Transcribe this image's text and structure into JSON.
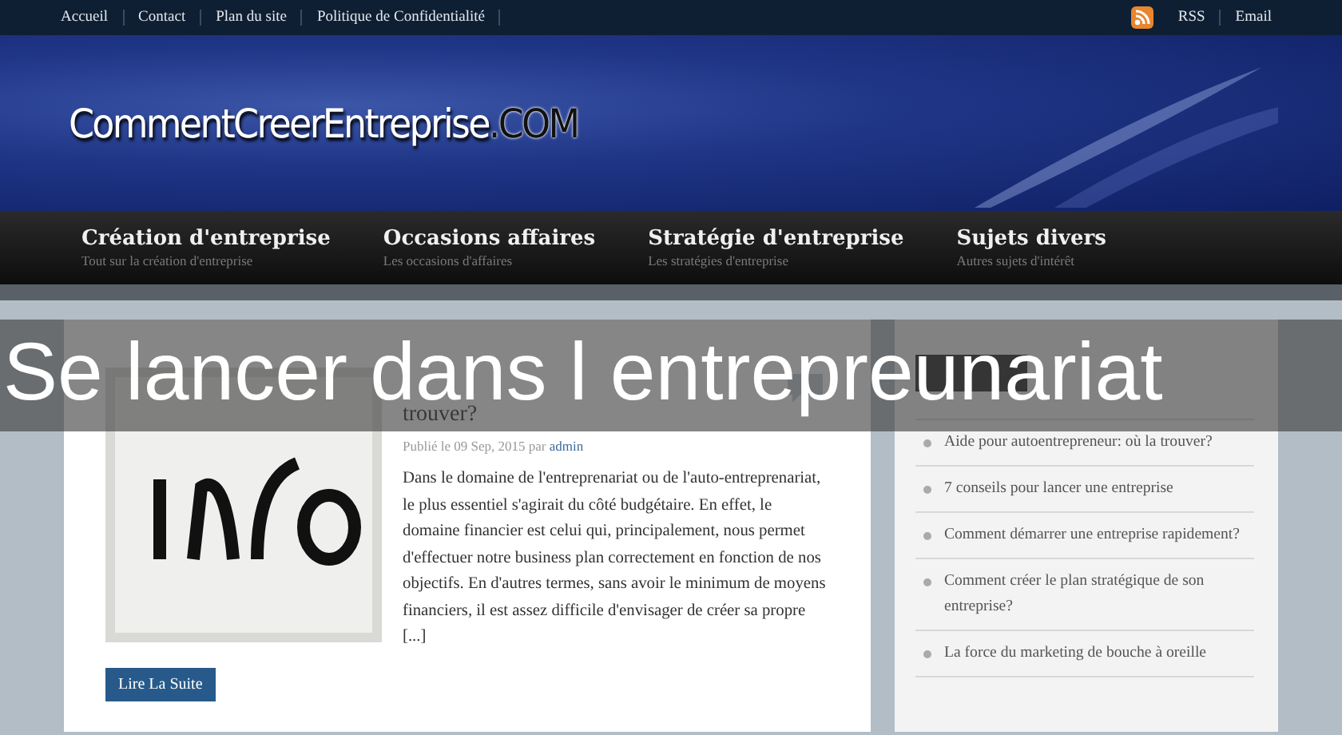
{
  "top_bar": {
    "links": [
      "Accueil",
      "Contact",
      "Plan du site",
      "Politique de Confidentialité"
    ],
    "right_links": [
      "RSS",
      "Email"
    ]
  },
  "logo": {
    "name": "CommentCreerEntreprise",
    "suffix": ".COM"
  },
  "nav": [
    {
      "label": "Création d'entreprise",
      "subtitle": "Tout sur la création d'entreprise"
    },
    {
      "label": "Occasions affaires",
      "subtitle": "Les occasions d'affaires"
    },
    {
      "label": "Stratégie d'entreprise",
      "subtitle": "Les stratégies d'entreprise"
    },
    {
      "label": "Sujets divers",
      "subtitle": "Autres sujets d'intérêt"
    }
  ],
  "post": {
    "title": "trouver?",
    "meta": "Publié le 09 Sep, 2015 par",
    "author": "admin",
    "excerpt": "Dans le domaine de l'entreprenariat ou de l'auto-entreprenariat, le plus essentiel s'agirait du côté budgétaire. En effet, le domaine financier est celui qui, principalement, nous permet d'effectuer notre business plan correctement en fonction de nos objectifs. En d'autres termes, sans avoir le minimum de moyens financiers, il est assez difficile d'envisager de créer sa propre [...]",
    "button": "Lire La Suite"
  },
  "sidebar": {
    "items": [
      "Aide pour autoentrepreneur: où la trouver?",
      "7 conseils pour lancer une entreprise",
      "Comment démarrer une entreprise rapidement?",
      "Comment créer le plan stratégique de son entreprise?",
      "La force du marketing de bouche à oreille"
    ]
  },
  "caption": "Se lancer dans l entrepreunariat"
}
